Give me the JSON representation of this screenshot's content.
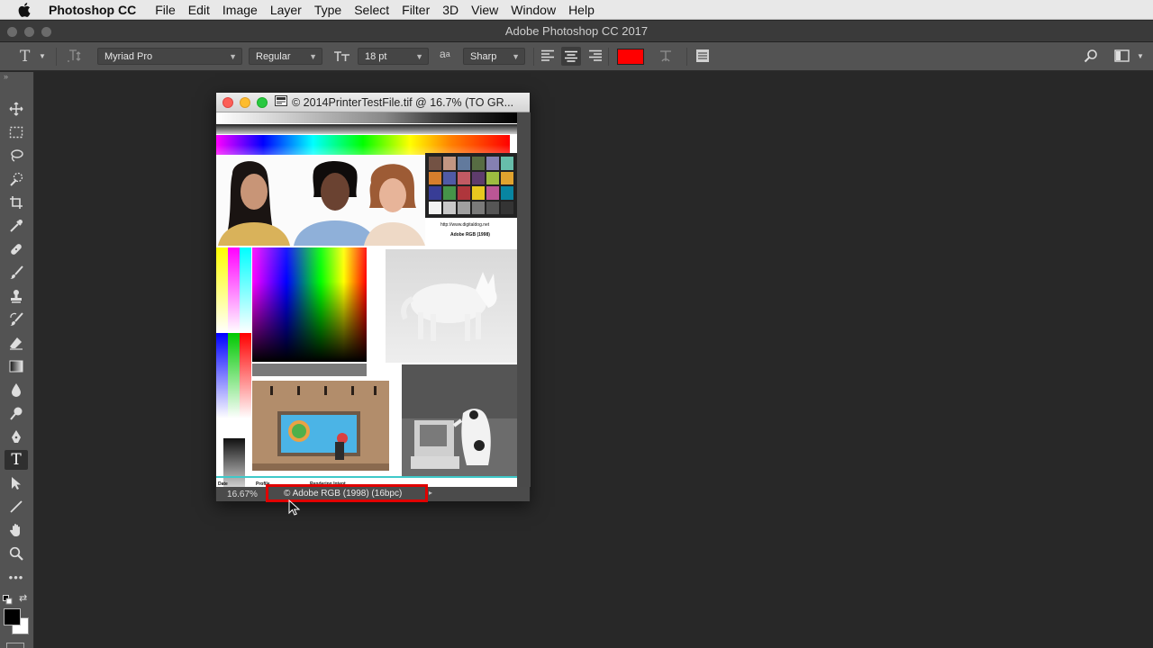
{
  "menubar": {
    "app_name": "Photoshop CC",
    "items": [
      "File",
      "Edit",
      "Image",
      "Layer",
      "Type",
      "Select",
      "Filter",
      "3D",
      "View",
      "Window",
      "Help"
    ]
  },
  "window": {
    "title": "Adobe Photoshop CC 2017"
  },
  "options": {
    "font_family": "Myriad Pro",
    "font_style": "Regular",
    "font_size": "18 pt",
    "antialias_icon": "a",
    "antialias": "Sharp",
    "text_color": "#ff0000"
  },
  "document": {
    "title": "© 2014PrinterTestFile.tif @ 16.7% (TO GR...",
    "zoom": "16.67%",
    "profile": "© Adobe RGB (1998) (16bpc)",
    "image_text": {
      "url": "http://www.digitaldog.net",
      "profile": "Adobe RGB (1998)",
      "footer_date": "Date",
      "footer_profile": "Profile",
      "footer_intent": "Rendering Intent"
    }
  },
  "colors": {
    "highlight": "#e00000",
    "foreground": "#000000",
    "background": "#ffffff"
  }
}
